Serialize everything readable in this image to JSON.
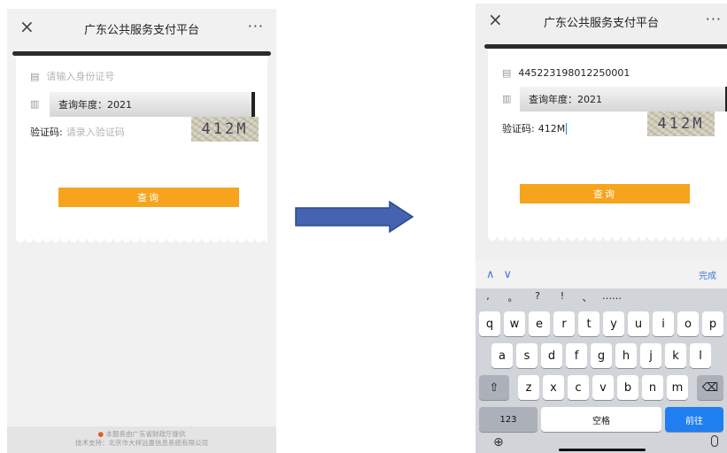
{
  "left": {
    "title": "广东公共服务支付平台",
    "close": "×",
    "more": "···",
    "id_placeholder": "请输入身份证号",
    "year_label": "查询年度：2021",
    "captcha_label": "验证码:",
    "captcha_placeholder": "请录入验证码",
    "captcha_image": "412M",
    "query_button": "查询",
    "footer_line1": "本服务由广东省财政厅提供",
    "footer_line2": "技术支持：北京市大祥远惠信息系统有限公司"
  },
  "right": {
    "title": "广东公共服务支付平台",
    "close": "×",
    "more": "···",
    "id_value": "445223198012250001",
    "year_label": "查询年度：2021",
    "captcha_label": "验证码:",
    "captcha_value": "412M",
    "captcha_image": "412M",
    "query_button": "查询",
    "keyboard": {
      "nav_up": "∧",
      "nav_down": "∨",
      "done": "完成",
      "symbols": [
        ",",
        "。",
        "?",
        "!",
        "、",
        "……"
      ],
      "row1": [
        "q",
        "w",
        "e",
        "r",
        "t",
        "y",
        "u",
        "i",
        "o",
        "p"
      ],
      "row2": [
        "a",
        "s",
        "d",
        "f",
        "g",
        "h",
        "j",
        "k",
        "l"
      ],
      "row3": [
        "z",
        "x",
        "c",
        "v",
        "b",
        "n",
        "m"
      ],
      "shift": "⇧",
      "backspace": "⌫",
      "num": "123",
      "space": "空格",
      "go": "前往",
      "globe": "⊕",
      "mic": "🎙"
    }
  },
  "colors": {
    "accent": "#f5a41c",
    "arrow": "#3f5fa8",
    "keyboard_go": "#1f7ef0"
  }
}
